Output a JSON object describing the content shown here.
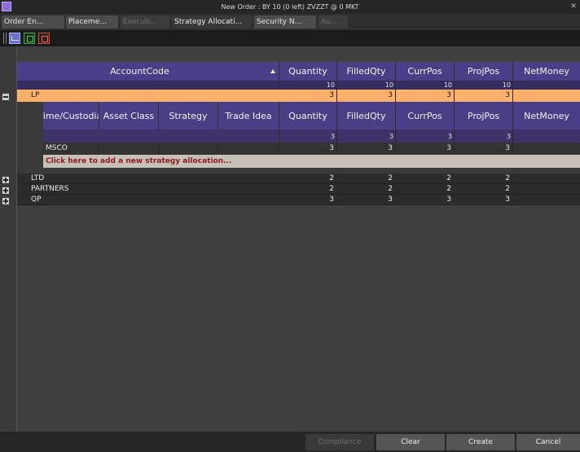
{
  "window": {
    "title": "New Order : BY 10 (0 left) ZVZZT @ 0 MKT",
    "close_glyph": "✕"
  },
  "tabs": [
    {
      "label": "Order En...",
      "state": "on"
    },
    {
      "label": "Placeme...",
      "state": "on"
    },
    {
      "label": "Executi...",
      "state": "dim"
    },
    {
      "label": "Strategy Allocati...",
      "state": "active"
    },
    {
      "label": "Security N...",
      "state": "on"
    },
    {
      "label": "Au...",
      "state": "dim"
    }
  ],
  "toolbar": {
    "icons": [
      "grid-view-icon",
      "excel-export-icon",
      "pdf-export-icon"
    ]
  },
  "grid": {
    "columns": [
      "AccountCode",
      "Quantity",
      "FilledQty",
      "CurrPos",
      "ProjPos",
      "NetMoney"
    ],
    "totals": [
      "10",
      "10",
      "10",
      "10"
    ],
    "lp_row": {
      "account": "LP",
      "values": [
        "3",
        "3",
        "3",
        "3"
      ]
    },
    "sub_columns": [
      "Prime/Custodian",
      "Asset Class",
      "Strategy",
      "Trade Idea",
      "Quantity",
      "FilledQty",
      "CurrPos",
      "ProjPos",
      "NetMoney"
    ],
    "sub_totals": [
      "3",
      "3",
      "3",
      "3"
    ],
    "sub_rows": [
      {
        "prime": "MSCO",
        "values": [
          "3",
          "3",
          "3",
          "3"
        ]
      }
    ],
    "add_row_label": "Click here to add a new strategy allocation...",
    "accounts": [
      {
        "account": "LTD",
        "values": [
          "2",
          "2",
          "2",
          "2"
        ]
      },
      {
        "account": "PARTNERS",
        "values": [
          "2",
          "2",
          "2",
          "2"
        ]
      },
      {
        "account": "QP",
        "values": [
          "3",
          "3",
          "3",
          "3"
        ]
      }
    ]
  },
  "footer": {
    "compliance_label": "Compliance",
    "clear_label": "Clear",
    "create_label": "Create",
    "cancel_label": "Cancel"
  },
  "colors": {
    "header": "#4a3f86",
    "lp_row": "#ffb06b",
    "add_row_text": "#8b1a1a"
  }
}
